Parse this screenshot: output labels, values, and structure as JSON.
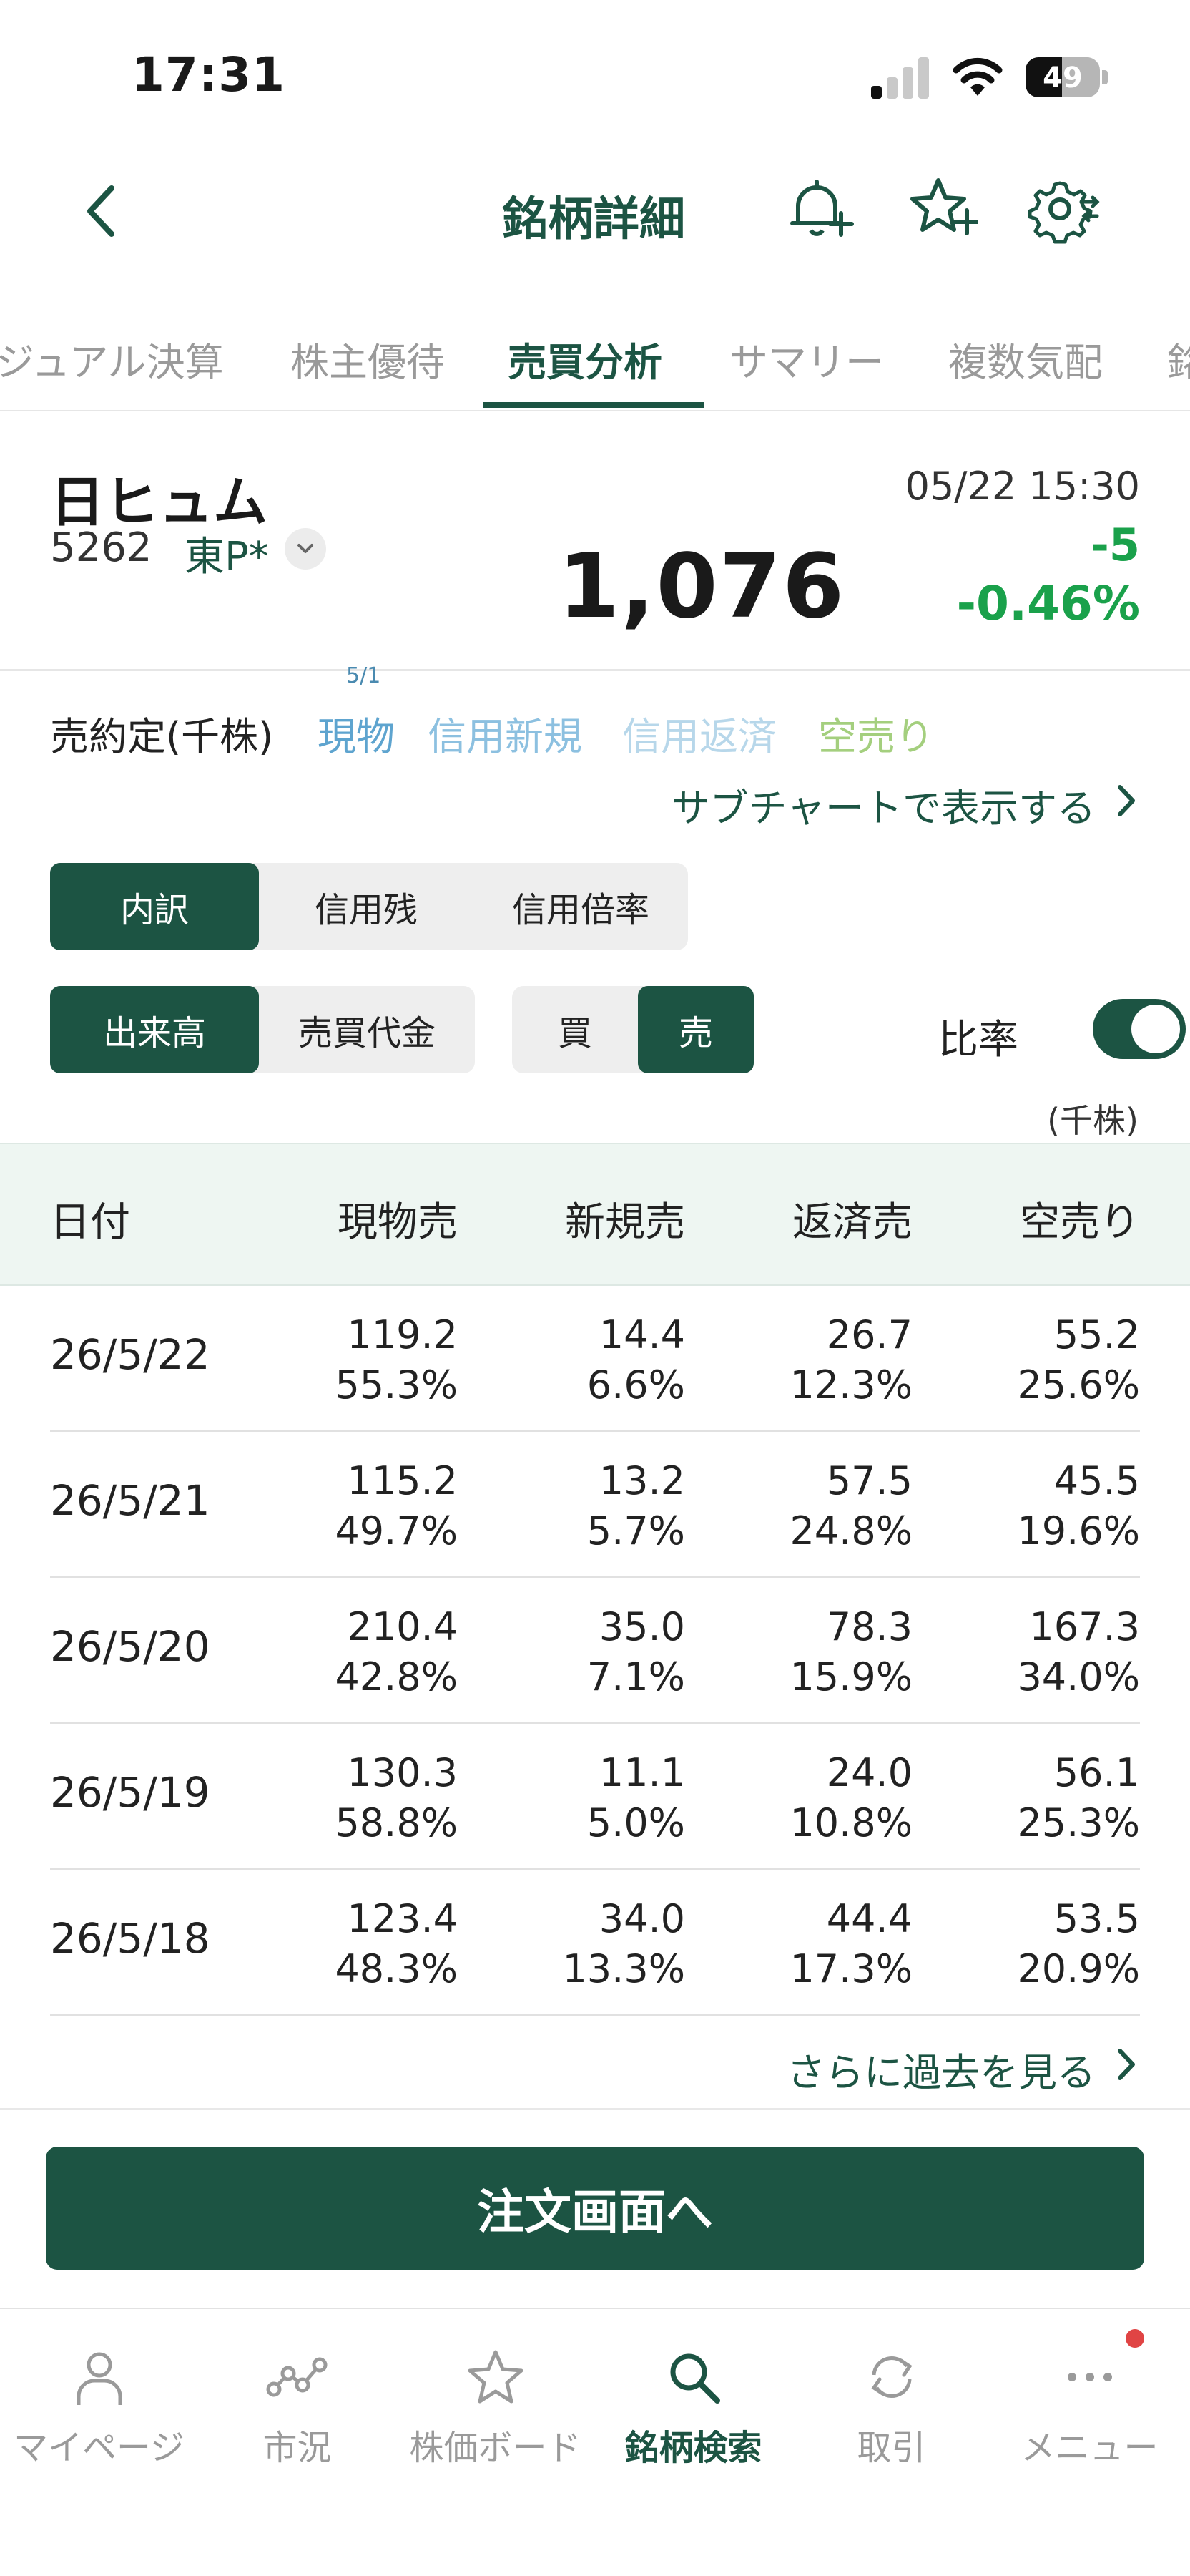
{
  "status_bar": {
    "time": "17:31",
    "battery": "49",
    "battery_level": 0.49
  },
  "header": {
    "title": "銘柄詳細"
  },
  "tabs": [
    {
      "label": "ジュアル決算"
    },
    {
      "label": "株主優待"
    },
    {
      "label": "売買分析",
      "active": true
    },
    {
      "label": "サマリー"
    },
    {
      "label": "複数気配"
    },
    {
      "label": "銘"
    }
  ],
  "stock": {
    "name": "日ヒュム",
    "code": "5262",
    "market": "東P*",
    "price": "1,076",
    "datetime": "05/22 15:30",
    "change": "-5",
    "change_pct": "-0.46%"
  },
  "legend": {
    "marker": "5/1",
    "label": "売約定(千株)",
    "items": [
      {
        "label": "現物",
        "color": "#5ea4cf"
      },
      {
        "label": "信用新規",
        "color": "#8cc0e0"
      },
      {
        "label": "信用返済",
        "color": "#b7d7ea"
      },
      {
        "label": "空売り",
        "color": "#a4cf7e"
      }
    ],
    "subchart_link": "サブチャートで表示する"
  },
  "controls": {
    "view_tabs": [
      "内訳",
      "信用残",
      "信用倍率"
    ],
    "metric_tabs": [
      "出来高",
      "売買代金"
    ],
    "side_tabs": [
      "買",
      "売"
    ],
    "ratio_label": "比率",
    "ratio_on": true,
    "unit": "(千株)"
  },
  "table": {
    "headers": [
      "日付",
      "現物売",
      "新規売",
      "返済売",
      "空売り"
    ],
    "rows": [
      {
        "date": "26/5/22",
        "cells": [
          [
            "119.2",
            "55.3%"
          ],
          [
            "14.4",
            "6.6%"
          ],
          [
            "26.7",
            "12.3%"
          ],
          [
            "55.2",
            "25.6%"
          ]
        ]
      },
      {
        "date": "26/5/21",
        "cells": [
          [
            "115.2",
            "49.7%"
          ],
          [
            "13.2",
            "5.7%"
          ],
          [
            "57.5",
            "24.8%"
          ],
          [
            "45.5",
            "19.6%"
          ]
        ]
      },
      {
        "date": "26/5/20",
        "cells": [
          [
            "210.4",
            "42.8%"
          ],
          [
            "35.0",
            "7.1%"
          ],
          [
            "78.3",
            "15.9%"
          ],
          [
            "167.3",
            "34.0%"
          ]
        ]
      },
      {
        "date": "26/5/19",
        "cells": [
          [
            "130.3",
            "58.8%"
          ],
          [
            "11.1",
            "5.0%"
          ],
          [
            "24.0",
            "10.8%"
          ],
          [
            "56.1",
            "25.3%"
          ]
        ]
      },
      {
        "date": "26/5/18",
        "cells": [
          [
            "123.4",
            "48.3%"
          ],
          [
            "34.0",
            "13.3%"
          ],
          [
            "44.4",
            "17.3%"
          ],
          [
            "53.5",
            "20.9%"
          ]
        ]
      }
    ],
    "more_link": "さらに過去を見る"
  },
  "order_button": "注文画面へ",
  "bottom_nav": [
    {
      "label": "マイページ",
      "icon": "person-icon"
    },
    {
      "label": "市況",
      "icon": "market-chart-icon"
    },
    {
      "label": "株価ボード",
      "icon": "star-icon"
    },
    {
      "label": "銘柄検索",
      "icon": "search-icon",
      "active": true
    },
    {
      "label": "取引",
      "icon": "refresh-icon"
    },
    {
      "label": "メニュー",
      "icon": "more-icon",
      "badge": true
    }
  ],
  "colors": {
    "accent": "#1c5443",
    "up": "#1aa14b",
    "badge": "#e04444"
  }
}
